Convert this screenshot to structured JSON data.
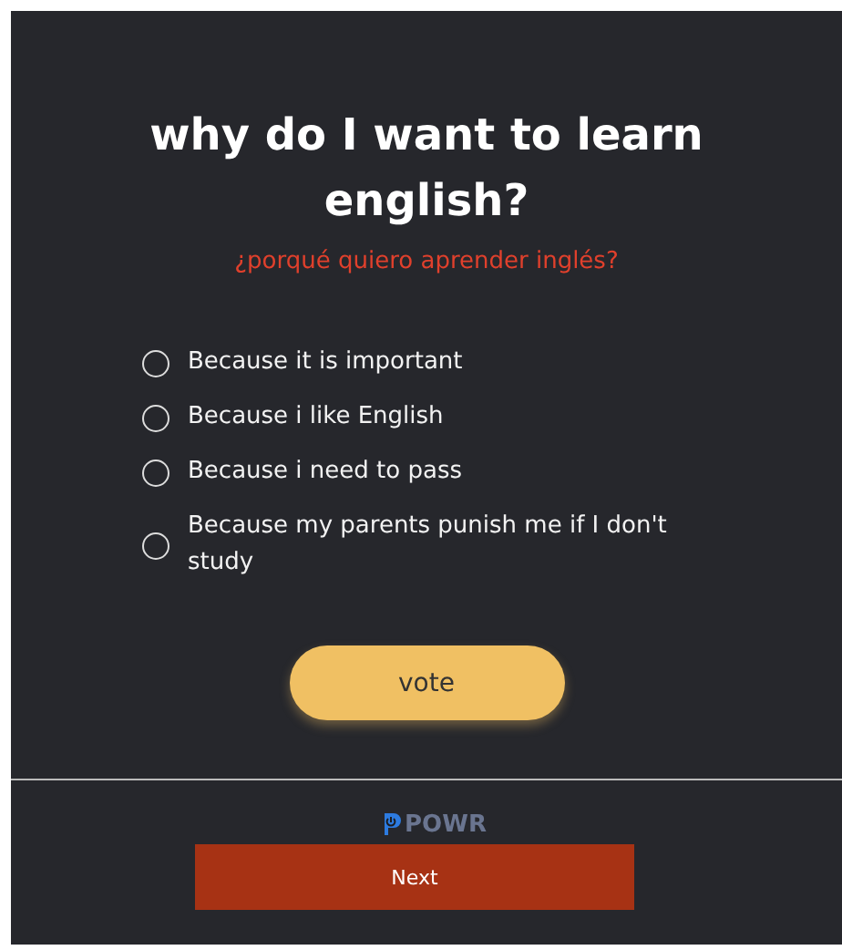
{
  "poll": {
    "title": "why do I want to learn english?",
    "subtitle": "¿porqué quiero aprender inglés?",
    "options": [
      {
        "label": "Because it is important",
        "selected": false
      },
      {
        "label": "Because i like English",
        "selected": false
      },
      {
        "label": "Because i need to pass",
        "selected": false
      },
      {
        "label": "Because my parents punish me if I don't study",
        "selected": false
      }
    ],
    "vote_button": "vote"
  },
  "footer": {
    "brand": "POWR",
    "next_button": "Next"
  }
}
